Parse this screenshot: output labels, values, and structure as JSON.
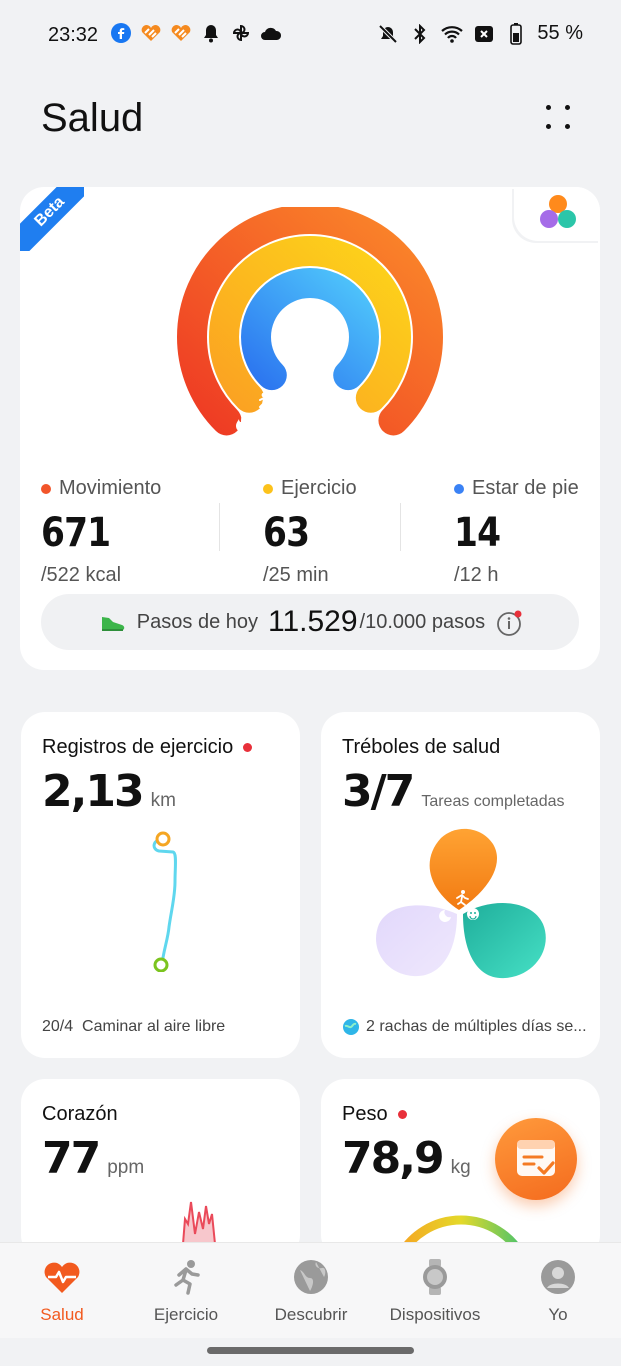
{
  "status_bar": {
    "time": "23:32",
    "battery": "55 %",
    "left_icons": [
      "facebook-icon",
      "heart-app-icon",
      "heart-app-icon",
      "bell-icon",
      "pinwheel-icon",
      "cloud-icon"
    ],
    "right_icons": [
      "mute-icon",
      "bluetooth-icon",
      "wifi-icon",
      "no-sim-icon",
      "battery-icon"
    ]
  },
  "header": {
    "title": "Salud"
  },
  "rings_card": {
    "badge": "Beta",
    "rings": {
      "move": {
        "value": 671,
        "goal": 522,
        "color": "#f2552a"
      },
      "exercise": {
        "value": 63,
        "goal": 25,
        "color": "#fcc21b"
      },
      "stand": {
        "value": 14,
        "goal": 12,
        "color": "#3aa0f5"
      }
    },
    "metrics": [
      {
        "label": "Movimiento",
        "value": "671",
        "goal": "/522 kcal",
        "color": "#f2552a"
      },
      {
        "label": "Ejercicio",
        "value": "63",
        "goal": "/25 min",
        "color": "#fcc21b"
      },
      {
        "label": "Estar de pie",
        "value": "14",
        "goal": "/12 h",
        "color": "#3a82f5"
      }
    ],
    "steps": {
      "label": "Pasos de hoy",
      "value": "11.529",
      "goal": "/10.000 pasos"
    }
  },
  "tiles": {
    "exercise_records": {
      "title": "Registros de ejercicio",
      "value": "2,13",
      "unit": "km",
      "date": "20/4",
      "activity": "Caminar al aire libre"
    },
    "health_clovers": {
      "title": "Tréboles de salud",
      "value": "3/7",
      "unit": "Tareas completadas",
      "footer": "2 rachas de múltiples días se..."
    },
    "heart": {
      "title": "Corazón",
      "value": "77",
      "unit": "ppm"
    },
    "weight": {
      "title": "Peso",
      "value": "78,9",
      "unit": "kg"
    }
  },
  "bottom_nav": [
    {
      "label": "Salud",
      "icon": "heart-pulse-icon",
      "active": true
    },
    {
      "label": "Ejercicio",
      "icon": "running-icon",
      "active": false
    },
    {
      "label": "Descubrir",
      "icon": "globe-icon",
      "active": false
    },
    {
      "label": "Dispositivos",
      "icon": "watch-icon",
      "active": false
    },
    {
      "label": "Yo",
      "icon": "profile-icon",
      "active": false
    }
  ]
}
